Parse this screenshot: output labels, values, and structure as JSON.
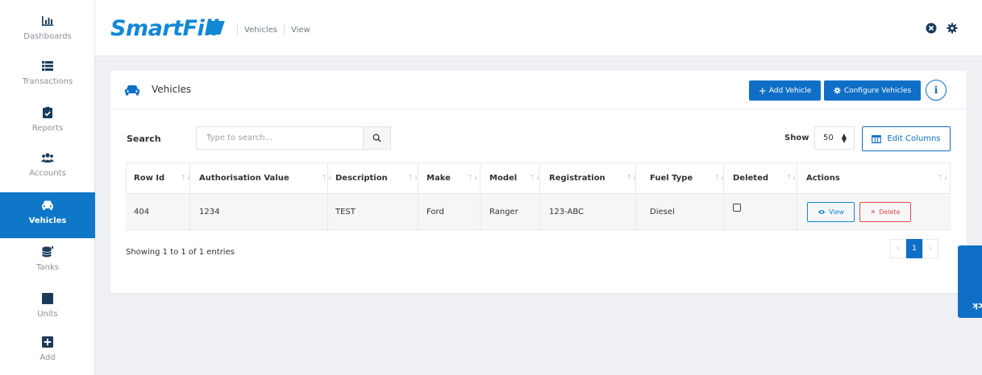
{
  "sidebar": {
    "items": [
      {
        "label": "Dashboards",
        "icon": "bar-chart-icon"
      },
      {
        "label": "Transactions",
        "icon": "list-icon"
      },
      {
        "label": "Reports",
        "icon": "clipboard-check-icon"
      },
      {
        "label": "Accounts",
        "icon": "users-icon"
      },
      {
        "label": "Vehicles",
        "icon": "car-icon",
        "active": true
      },
      {
        "label": "Tanks",
        "icon": "tank-icon"
      },
      {
        "label": "Units",
        "icon": "square-icon"
      },
      {
        "label": "Add",
        "icon": "plus-square-icon"
      }
    ]
  },
  "header": {
    "logo": "SmartFill",
    "breadcrumb": [
      "Vehicles",
      "View"
    ]
  },
  "card": {
    "title": "Vehicles",
    "add_button": "Add Vehicle",
    "configure_button": "Configure Vehicles",
    "info_label": "i"
  },
  "search": {
    "label": "Search",
    "placeholder": "Type to search..."
  },
  "show": {
    "label": "Show",
    "value": "50"
  },
  "edit_columns": "Edit Columns",
  "table": {
    "columns": [
      "Row Id",
      "Authorisation Value",
      "Description",
      "Make",
      "Model",
      "Registration",
      "Fuel Type",
      "Deleted",
      "Actions"
    ],
    "rows": [
      {
        "row_id": "404",
        "auth_value": "1234",
        "description": "TEST",
        "make": "Ford",
        "model": "Ranger",
        "registration": "123-ABC",
        "fuel_type": "Diesel",
        "deleted": false,
        "view_label": "View",
        "delete_label": "Delete"
      }
    ]
  },
  "footer": {
    "showing": "Showing 1 to 1 of 1 entries",
    "pages": [
      "‹",
      "1",
      "›"
    ],
    "current_page": "1"
  },
  "feedback": "Feedback",
  "colors": {
    "primary": "#0f6fc6",
    "brand": "#1288d4",
    "danger": "#e04b4b",
    "sidebar_active": "#0f77c7"
  }
}
